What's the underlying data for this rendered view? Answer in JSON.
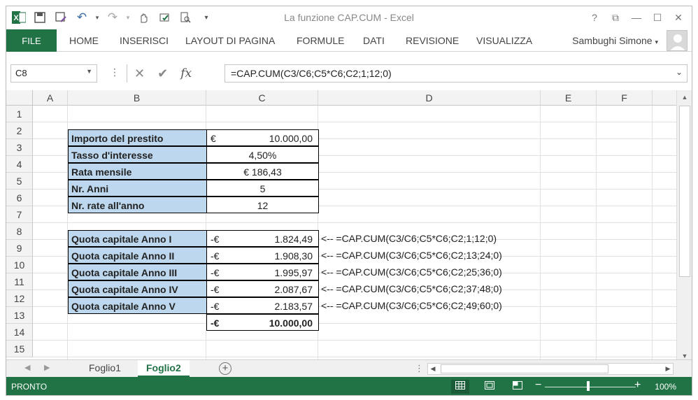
{
  "window": {
    "title": "La funzione CAP.CUM - Excel"
  },
  "qat": {
    "excel": "x",
    "save": "💾",
    "undo": "↶",
    "redo": "↷",
    "more": "▾"
  },
  "controls": {
    "help": "?",
    "ribbon": "⧉",
    "minimize": "—",
    "maximize": "☐",
    "close": "✕"
  },
  "ribbon": {
    "file": "FILE",
    "tabs": [
      "HOME",
      "INSERISCI",
      "LAYOUT DI PAGINA",
      "FORMULE",
      "DATI",
      "REVISIONE",
      "VISUALIZZA"
    ],
    "user": "Sambughi Simone"
  },
  "formula_bar": {
    "name_box": "C8",
    "formula": "=CAP.CUM(C3/C6;C5*C6;C2;1;12;0)",
    "cancel_icon": "✕",
    "enter_icon": "✔",
    "fx": "fx"
  },
  "columns": [
    "A",
    "B",
    "C",
    "D",
    "E",
    "F"
  ],
  "rows": [
    "1",
    "2",
    "3",
    "4",
    "5",
    "6",
    "7",
    "8",
    "9",
    "10",
    "11",
    "12",
    "13",
    "14",
    "15"
  ],
  "inputs": [
    {
      "label": "Importo del prestito",
      "currency": "€",
      "value": "10.000,00"
    },
    {
      "label": "Tasso d'interesse",
      "value": "4,50%"
    },
    {
      "label": "Rata mensile",
      "value": "€ 186,43"
    },
    {
      "label": "Nr. Anni",
      "value": "5"
    },
    {
      "label": "Nr. rate all'anno",
      "value": "12"
    }
  ],
  "results": [
    {
      "label": "Quota capitale Anno I",
      "currency": "-€",
      "value": "1.824,49",
      "note": "<-- =CAP.CUM(C3/C6;C5*C6;C2;1;12;0)"
    },
    {
      "label": "Quota capitale Anno II",
      "currency": "-€",
      "value": "1.908,30",
      "note": "<-- =CAP.CUM(C3/C6;C5*C6;C2;13;24;0)"
    },
    {
      "label": "Quota capitale Anno III",
      "currency": "-€",
      "value": "1.995,97",
      "note": "<-- =CAP.CUM(C3/C6;C5*C6;C2;25;36;0)"
    },
    {
      "label": "Quota capitale Anno IV",
      "currency": "-€",
      "value": "2.087,67",
      "note": "<-- =CAP.CUM(C3/C6;C5*C6;C2;37;48;0)"
    },
    {
      "label": "Quota capitale Anno V",
      "currency": "-€",
      "value": "2.183,57",
      "note": "<-- =CAP.CUM(C3/C6;C5*C6;C2;49;60;0)"
    }
  ],
  "total": {
    "currency": "-€",
    "value": "10.000,00"
  },
  "sheets": {
    "tab1": "Foglio1",
    "tab2": "Foglio2",
    "active": "Foglio2",
    "add": "+"
  },
  "status": {
    "text": "PRONTO",
    "zoom": "100%",
    "zoom_minus": "−",
    "zoom_plus": "+"
  }
}
